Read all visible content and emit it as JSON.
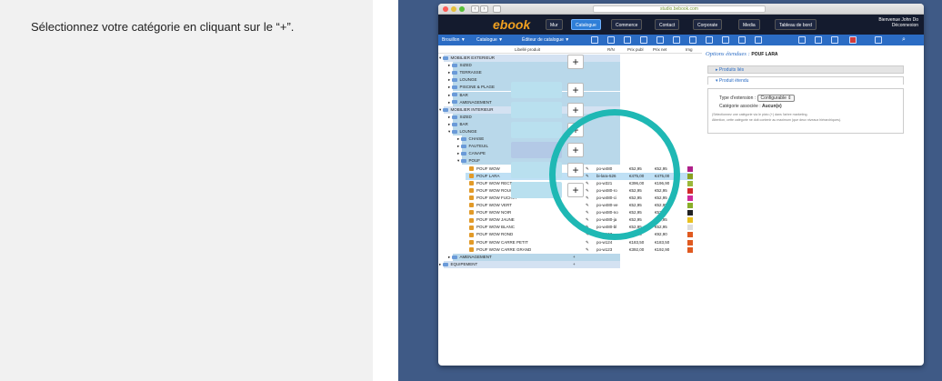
{
  "instruction": "Sélectionnez votre catégorie en cliquant sur le “+”.",
  "browser": {
    "url": "studio.bebook.com"
  },
  "app": {
    "logo": "ebook",
    "tabs": [
      "Mur",
      "Catalogue",
      "Commerce",
      "Contact",
      "Corporate",
      "Media",
      "Tableau de bord"
    ],
    "welcome": "Bienvenue John Do",
    "logout": "Déconnexion"
  },
  "breadcrumb": [
    "Brouillon ▼",
    "Catalogue ▼",
    "Éditeur de catalogue ▼"
  ],
  "columns": {
    "product": "Libellé produit",
    "ref": "R/N",
    "price_public": "Prix publ",
    "price_net": "Prix net",
    "img": "Img"
  },
  "tree": [
    {
      "label": "MOBILIER EXTERIEUR",
      "level": 0,
      "type": "folder",
      "open": true
    },
    {
      "label": "SIZED",
      "level": 1,
      "type": "folder"
    },
    {
      "label": "TERRASSE",
      "level": 1,
      "type": "folder"
    },
    {
      "label": "LOUNGE",
      "level": 1,
      "type": "folder"
    },
    {
      "label": "PISCINE & PLAGE",
      "level": 1,
      "type": "folder"
    },
    {
      "label": "BAR",
      "level": 1,
      "type": "folder"
    },
    {
      "label": "AMENAGEMENT",
      "level": 1,
      "type": "folder"
    },
    {
      "label": "MOBILIER INTERIEUR",
      "level": 0,
      "type": "folder",
      "open": true
    },
    {
      "label": "SIZED",
      "level": 1,
      "type": "folder"
    },
    {
      "label": "BAR",
      "level": 1,
      "type": "folder"
    },
    {
      "label": "LOUNGE",
      "level": 1,
      "type": "folder",
      "open": true
    },
    {
      "label": "CHAISE",
      "level": 2,
      "type": "folder"
    },
    {
      "label": "FAUTEUIL",
      "level": 2,
      "type": "folder"
    },
    {
      "label": "CANAPE",
      "level": 2,
      "type": "folder"
    },
    {
      "label": "POUF",
      "level": 2,
      "type": "folder",
      "open": true
    }
  ],
  "products": [
    {
      "name": "POUF WOW",
      "ref": "po-w480",
      "pub": "€52,95",
      "net": "€52,95",
      "color": "#b0208a"
    },
    {
      "name": "POUF LARA",
      "ref": "bi-lara-526",
      "pub": "€475,00",
      "net": "€475,00",
      "color": "#8aa020",
      "selected": true
    },
    {
      "name": "POUF WOW RECTANGLE",
      "ref": "po-w321",
      "pub": "€396,00",
      "net": "€196,90",
      "color": "#9bb83a"
    },
    {
      "name": "POUF WOW ROUGE",
      "ref": "po-w480-ro",
      "pub": "€52,95",
      "net": "€52,95",
      "color": "#d22a2a"
    },
    {
      "name": "POUF WOW FUCHIA",
      "ref": "po-w480-ci",
      "pub": "€52,95",
      "net": "€52,95",
      "color": "#d02a9a"
    },
    {
      "name": "POUF WOW VERT",
      "ref": "po-w480-ve",
      "pub": "€52,95",
      "net": "€52,95",
      "color": "#8aae2a"
    },
    {
      "name": "POUF WOW NOIR",
      "ref": "po-w480-no",
      "pub": "€52,95",
      "net": "€52,95",
      "color": "#222222"
    },
    {
      "name": "POUF WOW JAUNE",
      "ref": "po-w480-ja",
      "pub": "€52,95",
      "net": "€52,95",
      "color": "#e8c020"
    },
    {
      "name": "POUF WOW BLANC",
      "ref": "po-w480-bl",
      "pub": "€52,95",
      "net": "€52,95",
      "color": "#dddddd"
    },
    {
      "name": "POUF WOW ROND",
      "ref": "po-w123",
      "pub": "€92,90",
      "net": "€92,90",
      "color": "#e05a20"
    },
    {
      "name": "POUF WOW CARRE PETIT",
      "ref": "po-w124",
      "pub": "€183,50",
      "net": "€183,50",
      "color": "#e05a20"
    },
    {
      "name": "POUF WOW CARRE GRAND",
      "ref": "po-w123",
      "pub": "€392,00",
      "net": "€192,90",
      "color": "#e05a20"
    }
  ],
  "tree_bottom": [
    {
      "label": "AMENAGEMENT",
      "level": 1
    },
    {
      "label": "EQUIPEMENT",
      "level": 0
    }
  ],
  "options": {
    "title": "Options étendues :",
    "product": "POUF LARA",
    "linked": "▸ Produits liés",
    "extended": "▾ Produit étendu",
    "ext_type_label": "Type d'extension :",
    "ext_type_value": "Configurable ⇕",
    "cat_label": "Catégorie associée :",
    "cat_value": "Aucun(e)",
    "note1": "(Sélectionnez une catégorie via le picto (+) dans l'arbre marketing.",
    "note2": "Attention, cette catégorie ne doit contenir au maximum (que deux niveaux hiérarchiques)."
  },
  "plus": "+"
}
